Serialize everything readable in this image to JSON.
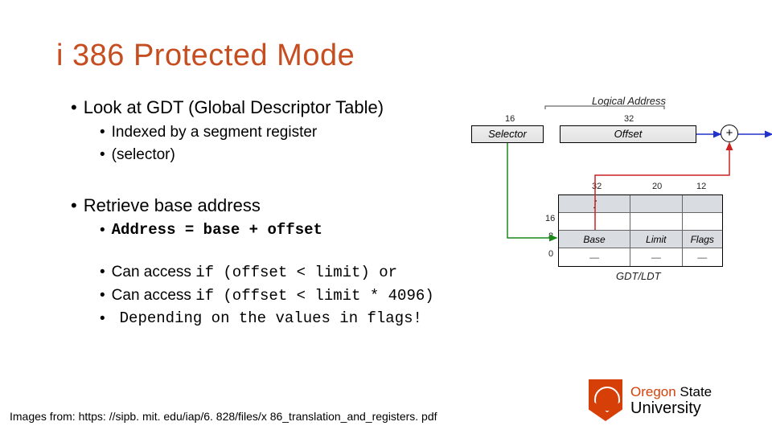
{
  "title": "i 386 Protected Mode",
  "bullets": {
    "b1": "Look at GDT (Global Descriptor Table)",
    "b1a": "Indexed by a segment register",
    "b1b": "(selector)",
    "b2": "Retrieve base address",
    "b2a": "Address = base + offset",
    "b2b_pre": "Can access ",
    "b2b_code": "if (offset < limit) or",
    "b2c_pre": "Can access ",
    "b2c_code": "if (offset < limit * 4096)",
    "b2d": "Depending on the values in flags!"
  },
  "citation": "Images from: https: //sipb. mit. edu/iap/6. 828/files/x 86_translation_and_registers. pdf",
  "diagram": {
    "logical_address": "Logical Address",
    "bits_selector": "16",
    "bits_offset": "32",
    "selector": "Selector",
    "offset": "Offset",
    "col_bits": {
      "base": "32",
      "limit": "20",
      "flags": "12"
    },
    "rows_left": [
      "16",
      "8",
      "0"
    ],
    "headers": {
      "base": "Base",
      "limit": "Limit",
      "flags": "Flags"
    },
    "table_label": "GDT/LDT",
    "dash": "—"
  },
  "logo": {
    "line1a": "Oregon",
    "line1b": " State",
    "line2": "University"
  }
}
